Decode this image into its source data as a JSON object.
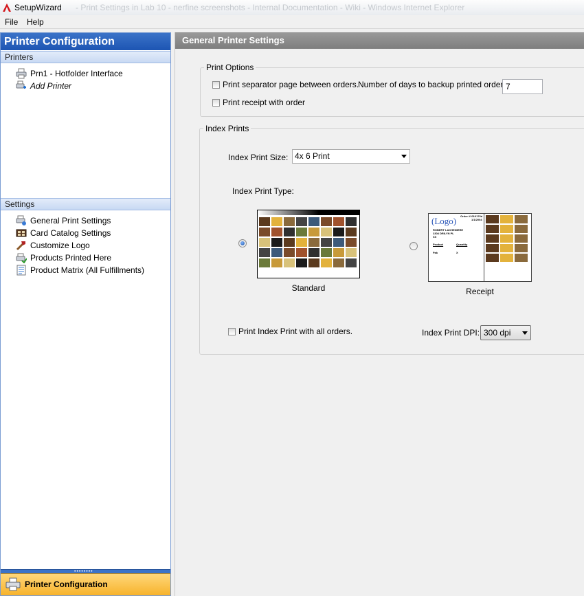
{
  "window": {
    "title": "SetupWizard",
    "ghost_title": "- Print Settings in Lab 10 - nerfine screenshots - Internal Documentation - Wiki - Windows Internet Explorer"
  },
  "menu": {
    "file": "File",
    "help": "Help"
  },
  "sidebar": {
    "header": "Printer Configuration",
    "printers_group": "Printers",
    "printers": [
      {
        "label": "Prn1 - Hotfolder Interface",
        "icon": "printer-icon"
      },
      {
        "label": "Add Printer",
        "icon": "add-printer-icon"
      }
    ],
    "settings_group": "Settings",
    "settings": [
      {
        "label": "General Print Settings",
        "icon": "print-settings-icon"
      },
      {
        "label": "Card Catalog Settings",
        "icon": "card-catalog-icon"
      },
      {
        "label": "Customize Logo",
        "icon": "logo-tool-icon"
      },
      {
        "label": "Products Printed Here",
        "icon": "products-icon"
      },
      {
        "label": "Product Matrix (All Fulfillments)",
        "icon": "matrix-icon"
      }
    ],
    "footer_label": "Printer Configuration"
  },
  "main": {
    "header": "General Printer Settings",
    "print_options": {
      "title": "Print Options",
      "separator_label": "Print separator page between orders.",
      "receipt_label": "Print receipt with order",
      "backup_days_label": "Number of days to backup printed orders:",
      "backup_days_value": "7"
    },
    "index_prints": {
      "title": "Index Prints",
      "size_label": "Index Print Size:",
      "size_value": "4x 6 Print",
      "type_label": "Index Print Type:",
      "standard_caption": "Standard",
      "receipt_caption": "Receipt",
      "selected_type": "Standard",
      "all_orders_label": "Print Index Print with all orders.",
      "dpi_label": "Index Print DPI:",
      "dpi_value": "300 dpi",
      "receipt_preview": {
        "logo": "(Logo)",
        "order_line1": "Order #1010176d",
        "order_line2": "1/1/2004",
        "name": "ROBERT LACHENIERE",
        "address": "2304 DRILYN PL",
        "city": "XX",
        "col_product": "Product",
        "col_quantity": "Quantity",
        "row_product": "Pak",
        "row_quantity": "X"
      }
    }
  },
  "colors": {
    "accent": "#1d55b3",
    "footer": "#f7b32b",
    "header_gray": "#8a8a8a"
  }
}
